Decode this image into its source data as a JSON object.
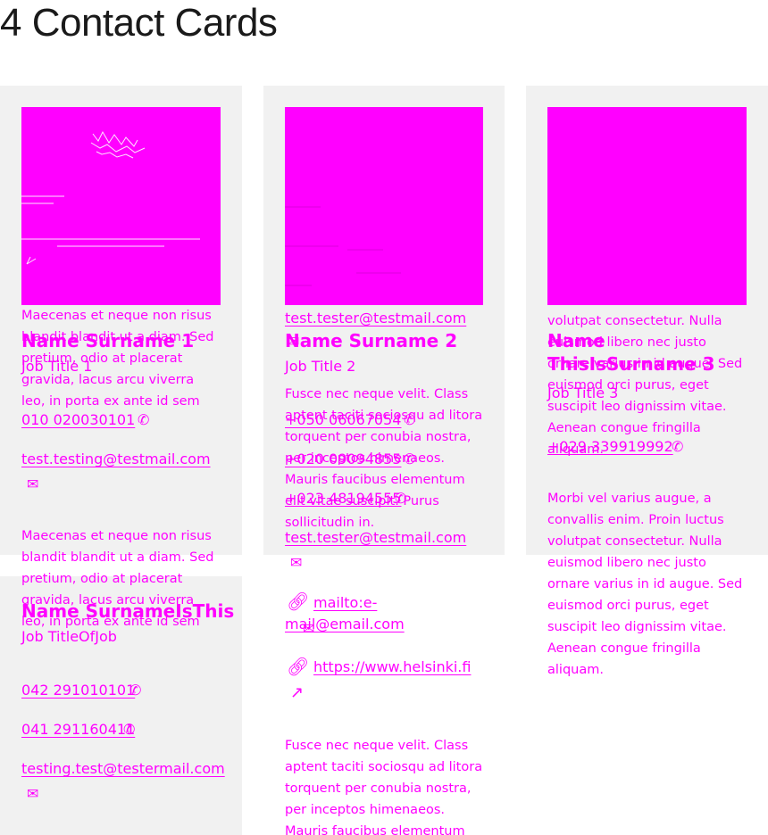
{
  "page": {
    "title": "4 Contact Cards"
  },
  "card1": {
    "desc": "Maecenas et neque non risus blandit blandit ut a diam. Sed pretium, odio at placerat gravida, lacus arcu viverra leo, in porta ex ante id sem",
    "name": "Name Surname 1",
    "job": "Job Title 1",
    "phone": "010 020030101",
    "email": "test.testing@testmail.com"
  },
  "card2": {
    "email_top": "test.tester@testmail.com",
    "name": "Name Surname 2",
    "job": "Job Title 2",
    "desc": "Fusce nec neque velit. Class aptent taciti sociosqu ad litora torquent per conubia nostra, per inceptos himenaeos. Mauris faucibus elementum elit vitae suscipit. Purus sollicitudin in.",
    "phone1": "+050 06067054",
    "phone2": "+020 09094855",
    "phone3": "+023 48194555",
    "email": "test.tester@testmail.com",
    "mail_link": "mailto:e-mail@email.com",
    "web_link": "https://www.helsinki.fi",
    "desc2": "Fusce nec neque velit. Class aptent taciti sociosqu ad litora torquent per conubia nostra, per inceptos himenaeos. Mauris faucibus elementum"
  },
  "card3": {
    "desc": "volutpat consectetur. Nulla euismod libero nec justo ornare varius in id augue. Sed euismod orci purus, eget suscipit leo dignissim vitae. Aenean congue fringilla aliquam.",
    "name": "Name ThisIsSurname 3",
    "job": "Job Title 3",
    "phone": "+029 339919992",
    "desc2": "Morbi vel varius augue, a convallis enim. Proin luctus volutpat consectetur. Nulla euismod libero nec justo ornare varius in id augue. Sed euismod orci purus, eget suscipit leo dignissim vitae. Aenean congue fringilla aliquam."
  },
  "card4": {
    "desc": "Maecenas et neque non risus blandit blandit ut a diam. Sed pretium, odio at placerat gravida, lacus arcu viverra leo, in porta ex ante id sem",
    "name": "Name SurnameIsThis",
    "job": "Job TitleOfJob",
    "phone1": "042 291010101",
    "phone2": "041 291160411",
    "email": "testing.test@testermail.com"
  },
  "icons": {
    "phone": "phone-icon",
    "mail": "mail-icon",
    "link": "link-icon",
    "external": "external-link-icon"
  },
  "colors": {
    "accent": "#ff00ff",
    "card_bg": "#f1f1f1",
    "title": "#1a1a1a"
  }
}
